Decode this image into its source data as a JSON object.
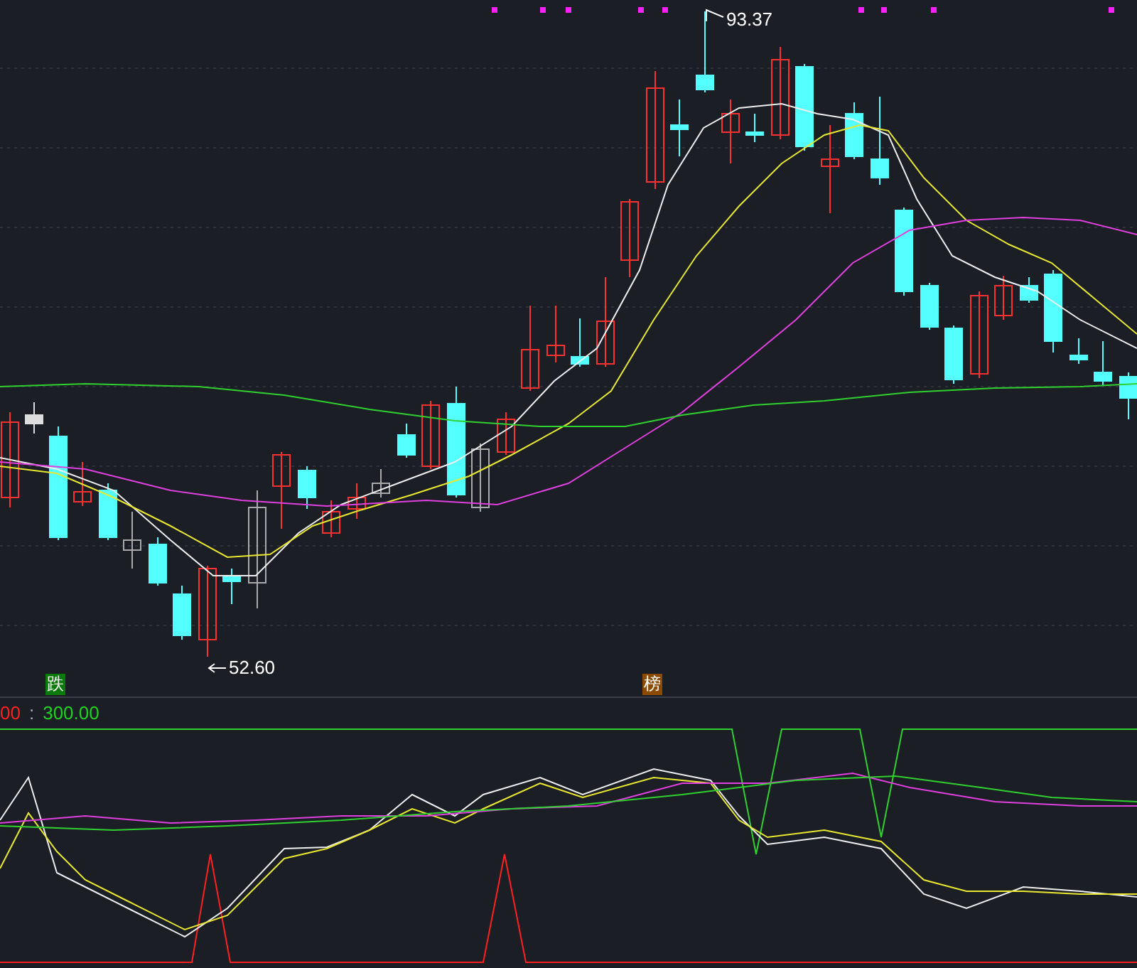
{
  "price_panel": {
    "high_label": "93.37",
    "low_label": "52.60",
    "signals": [
      {
        "text": "跌",
        "kind": "fall"
      },
      {
        "text": "榜",
        "kind": "list"
      }
    ]
  },
  "indicator_panel": {
    "separator": ":",
    "values": [
      {
        "text": "00",
        "color": "#ff2020"
      },
      {
        "text": "300.00",
        "color": "#20d020"
      }
    ]
  }
}
